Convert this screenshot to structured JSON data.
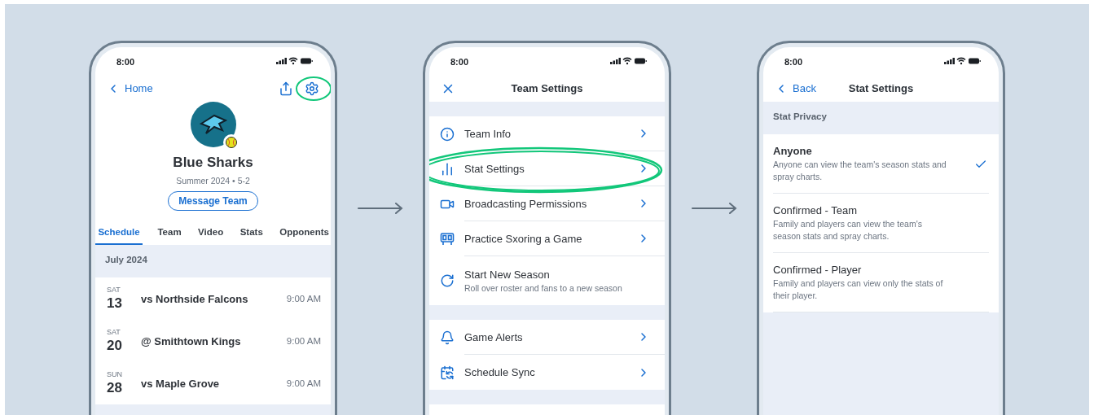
{
  "screens": [
    {
      "kind": "team",
      "time": "8:00",
      "back": "Home",
      "gear_circled": true,
      "team_name": "Blue Sharks",
      "season": "Summer 2024 • 5-2",
      "message_button": "Message Team",
      "tabs": [
        {
          "label": "Schedule",
          "selected": true
        },
        {
          "label": "Team",
          "selected": false
        },
        {
          "label": "Video",
          "selected": false
        },
        {
          "label": "Stats",
          "selected": false
        },
        {
          "label": "Opponents",
          "selected": false
        }
      ],
      "month": "July 2024",
      "games": [
        {
          "day": "SAT",
          "date": "13",
          "opponent": "vs Northside Falcons",
          "time": "9:00 AM"
        },
        {
          "day": "SAT",
          "date": "20",
          "opponent": "@ Smithtown Kings",
          "time": "9:00 AM"
        },
        {
          "day": "SUN",
          "date": "28",
          "opponent": "vs Maple Grove",
          "time": "9:00 AM"
        }
      ]
    },
    {
      "kind": "settings",
      "time": "8:00",
      "title": "Team Settings",
      "groups": [
        [
          {
            "label": "Team Info",
            "circled": false
          },
          {
            "label": "Stat Settings",
            "circled": true
          },
          {
            "label": "Broadcasting Permissions",
            "circled": false
          },
          {
            "label": "Practice Sxoring a Game",
            "circled": false
          },
          {
            "label": "Start New Season",
            "subtitle": "Roll over roster and fans to a new season",
            "circled": false
          }
        ],
        [
          {
            "label": "Game Alerts",
            "circled": false
          },
          {
            "label": "Schedule Sync",
            "circled": false
          }
        ]
      ]
    },
    {
      "kind": "privacy",
      "time": "8:00",
      "back": "Back",
      "title": "Stat Settings",
      "section": "Stat Privacy",
      "options": [
        {
          "label": "Anyone",
          "description": "Anyone can view the team's season stats and spray charts.",
          "selected": true
        },
        {
          "label": "Confirmed - Team",
          "description": "Family and players can view the team's season stats and spray charts.",
          "selected": false
        },
        {
          "label": "Confirmed - Player",
          "description": "Family and players can view only the stats of their player.",
          "selected": false
        }
      ]
    }
  ]
}
